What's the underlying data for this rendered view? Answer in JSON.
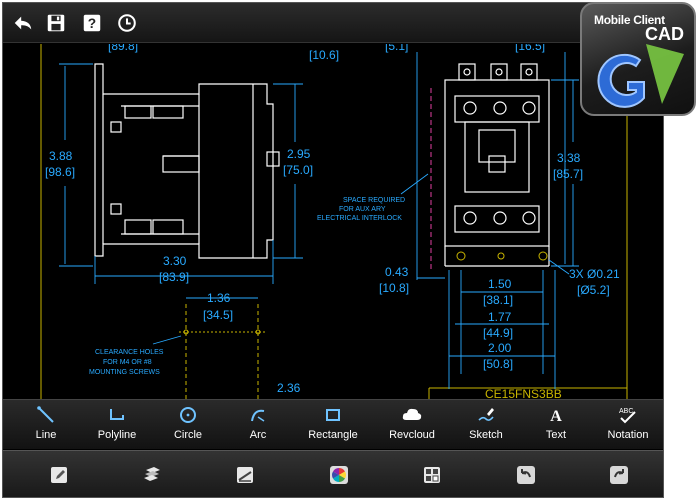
{
  "logo": {
    "line1": "Mobile Client",
    "line2": "CAD"
  },
  "topbar": {
    "icons": [
      "back-icon",
      "save-icon",
      "help-icon",
      "history-icon"
    ]
  },
  "drawing": {
    "left": {
      "top_a": "[89.8]",
      "top_b": "[10.6]",
      "height_in": "3.88",
      "height_mm": "[98.6]",
      "right_in": "2.95",
      "right_mm": "[75.0]",
      "width_in": "3.30",
      "width_mm": "[83.9]",
      "hole_in": "1.36",
      "hole_mm": "[34.5]",
      "clear_1": "CLEARANCE HOLES",
      "clear_2": "FOR M4 OR #8",
      "clear_3": "MOUNTING SCREWS",
      "bottom_val": "2.36"
    },
    "right": {
      "top_a": "[5.1]",
      "top_b": "[16.5]",
      "space_1": "SPACE REQUIRED",
      "space_2": "FOR AUX ARY",
      "space_3": "ELECTRICAL INTERLOCK",
      "h_in": "3.38",
      "h_mm": "[85.7]",
      "off_in": "0.43",
      "off_mm": "[10.8]",
      "w1_in": "1.50",
      "w1_mm": "[38.1]",
      "w2_in": "1.77",
      "w2_mm": "[44.9]",
      "w3_in": "2.00",
      "w3_mm": "[50.8]",
      "holes_in": "3X Ø0.21",
      "holes_mm": "[Ø5.2]",
      "part_no": "CE15FNS3BB"
    }
  },
  "tools": [
    {
      "label": "Line",
      "icon": "line-icon"
    },
    {
      "label": "Polyline",
      "icon": "polyline-icon"
    },
    {
      "label": "Circle",
      "icon": "circle-icon"
    },
    {
      "label": "Arc",
      "icon": "arc-icon"
    },
    {
      "label": "Rectangle",
      "icon": "rectangle-icon"
    },
    {
      "label": "Revcloud",
      "icon": "revcloud-icon"
    },
    {
      "label": "Sketch",
      "icon": "sketch-icon"
    },
    {
      "label": "Text",
      "icon": "text-icon"
    },
    {
      "label": "Notation",
      "icon": "notation-icon"
    }
  ],
  "bottombar": {
    "icons": [
      "edit-icon",
      "layers-icon",
      "measure-icon",
      "color-wheel-icon",
      "blocks-icon",
      "undo-icon",
      "redo-icon"
    ]
  },
  "colors": {
    "dimension": "#29aaff",
    "geometry": "#ffffff",
    "accent_yellow": "#e0c000"
  }
}
